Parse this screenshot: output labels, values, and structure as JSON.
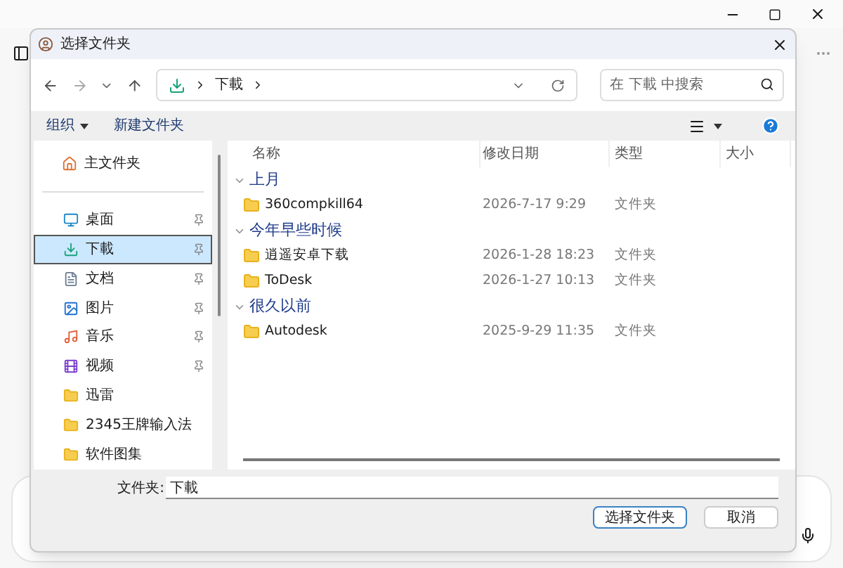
{
  "dialog": {
    "title": "选择文件夹",
    "address": {
      "path": [
        "下載"
      ]
    },
    "search": {
      "placeholder": "在 下載 中搜索"
    },
    "toolbar": [
      {
        "label": "组织",
        "kind": "menu"
      },
      {
        "label": "新建文件夹",
        "kind": "button"
      }
    ],
    "sidebar": {
      "home": "主文件夹",
      "items": [
        {
          "label": "桌面",
          "kind": "desktop",
          "pinned": true,
          "selected": false
        },
        {
          "label": "下載",
          "kind": "download",
          "pinned": true,
          "selected": true
        },
        {
          "label": "文档",
          "kind": "documents",
          "pinned": true,
          "selected": false
        },
        {
          "label": "图片",
          "kind": "pictures",
          "pinned": true,
          "selected": false
        },
        {
          "label": "音乐",
          "kind": "music",
          "pinned": true,
          "selected": false
        },
        {
          "label": "视频",
          "kind": "videos",
          "pinned": true,
          "selected": false
        },
        {
          "label": "迅雷",
          "kind": "folder",
          "pinned": false,
          "selected": false
        },
        {
          "label": "2345王牌输入法",
          "kind": "folder",
          "pinned": false,
          "selected": false
        },
        {
          "label": "软件图集",
          "kind": "folder",
          "pinned": false,
          "selected": false
        }
      ]
    },
    "columns": [
      "名称",
      "修改日期",
      "类型",
      "大小"
    ],
    "groups": [
      {
        "label": "上月",
        "expanded": true,
        "rows": [
          {
            "name": "360compkill64",
            "date": "2026-7-17 9:29",
            "type": "文件夹"
          }
        ]
      },
      {
        "label": "今年早些时候",
        "expanded": true,
        "rows": [
          {
            "name": "逍遥安卓下载",
            "date": "2026-1-28 18:23",
            "type": "文件夹"
          },
          {
            "name": "ToDesk",
            "date": "2026-1-27 10:13",
            "type": "文件夹"
          }
        ]
      },
      {
        "label": "很久以前",
        "expanded": true,
        "rows": [
          {
            "name": "Autodesk",
            "date": "2025-9-29 11:35",
            "type": "文件夹"
          }
        ]
      }
    ],
    "folder_field": {
      "label": "文件夹:",
      "value": "下載"
    },
    "buttons": [
      {
        "label": "选择文件夹",
        "kind": "primary"
      },
      {
        "label": "取消",
        "kind": "secondary"
      }
    ]
  }
}
